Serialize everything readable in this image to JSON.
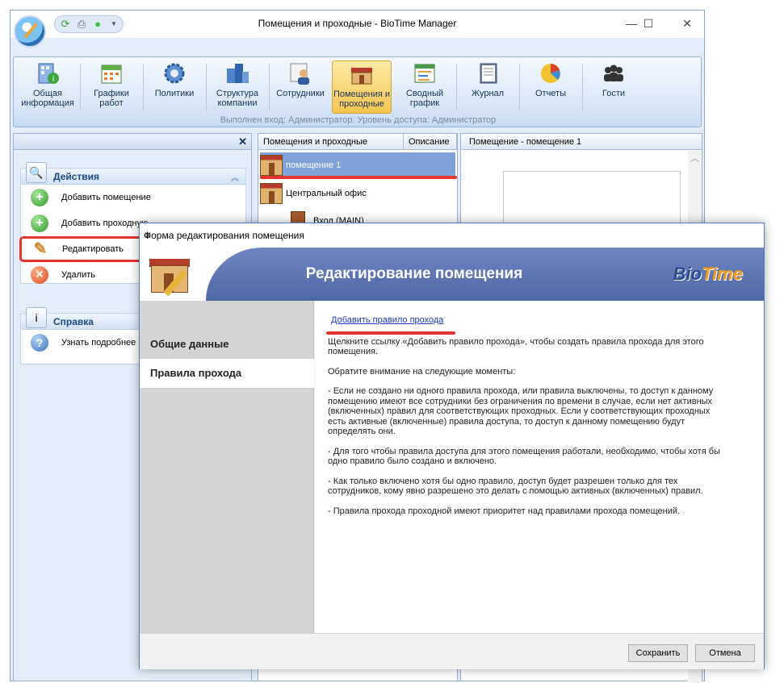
{
  "window": {
    "title": "Помещения и проходные - BioTime Manager",
    "minimize": "—",
    "maximize": "☐",
    "close": "✕"
  },
  "ribbon": {
    "buttons": [
      {
        "label": "Общая\nинформация",
        "icon": "info-icon"
      },
      {
        "label": "Графики\nработ",
        "icon": "calendar-icon"
      },
      {
        "label": "Политики",
        "icon": "gear-icon"
      },
      {
        "label": "Структура\nкомпании",
        "icon": "buildings-icon"
      },
      {
        "label": "Сотрудники",
        "icon": "employee-icon"
      },
      {
        "label": "Помещения и\nпроходные",
        "icon": "room-icon",
        "active": true
      },
      {
        "label": "Сводный\nграфик",
        "icon": "chart-icon"
      },
      {
        "label": "Журнал",
        "icon": "journal-icon"
      },
      {
        "label": "Отчеты",
        "icon": "pie-icon"
      },
      {
        "label": "Гости",
        "icon": "guests-icon"
      }
    ],
    "status": "Выполнен вход: Администратор. Уровень доступа: Администратор"
  },
  "left_panel": {
    "actions_title": "Действия",
    "actions": [
      {
        "label": "Добавить помещение",
        "icon": "add-icon"
      },
      {
        "label": "Добавить проходную",
        "icon": "add-icon"
      },
      {
        "label": "Редактировать",
        "icon": "pencil-icon"
      },
      {
        "label": "Удалить",
        "icon": "delete-icon"
      }
    ],
    "help_title": "Справка",
    "help_items": [
      {
        "label": "Узнать подробнее",
        "icon": "help-icon"
      }
    ]
  },
  "tree": {
    "col_name": "Помещения и проходные",
    "col_desc": "Описание",
    "rows": [
      {
        "label": "помещение 1",
        "selected": true
      },
      {
        "label": "Центральный офис"
      },
      {
        "label": "Вход (MAIN)"
      }
    ]
  },
  "right_panel": {
    "title": "Помещение - помещение 1"
  },
  "dialog": {
    "title": "Форма редактирования помещения",
    "banner_title": "Редактирование помещения",
    "logo_bio": "Bio",
    "logo_time": "Time",
    "nav": [
      "Общие данные",
      "Правила прохода"
    ],
    "link": "Добавить правило прохода",
    "paragraphs": [
      "Щелкните ссылку «Добавить правило прохода», чтобы создать правила прохода для этого помещения.",
      "Обратите внимание на следующие моменты:",
      "- Если не создано ни одного правила прохода, или правила выключены, то доступ к данному помещению имеют  все сотрудники без ограничения по времени в случае, если нет активных (включенных) правил для соответствующих проходных. Если у соответствующих проходных есть активные (включенные) правила доступа, то доступ к данному помещению будут определять они.",
      "- Для того чтобы правила доступа для этого помещения работали, необходимо, чтобы хотя бы одно правило было создано и включено.",
      "- Как только включено хотя бы одно правило, доступ будет разрешен только для тех сотрудников, кому явно разрешено это делать с помощью активных (включенных) правил.",
      "- Правила прохода проходной имеют приоритет над правилами прохода помещений."
    ],
    "save": "Сохранить",
    "cancel": "Отмена",
    "close": "✕"
  }
}
